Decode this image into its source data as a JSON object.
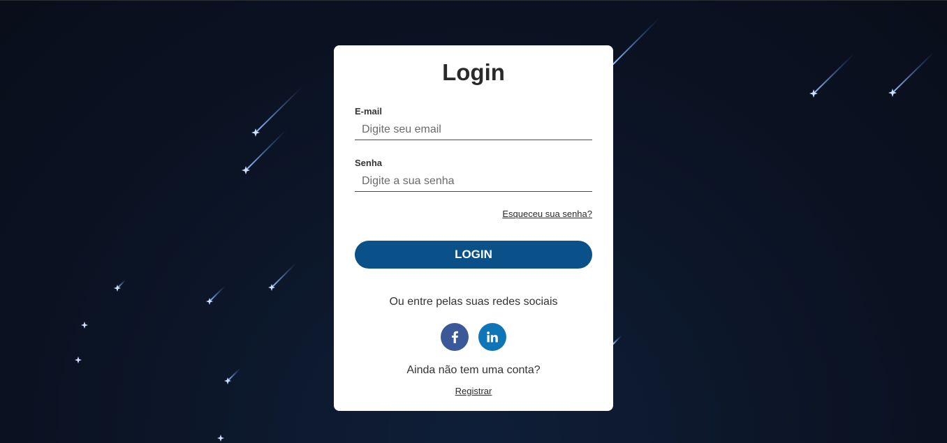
{
  "login": {
    "title": "Login",
    "email_label": "E-mail",
    "email_placeholder": "Digite seu email",
    "email_value": "",
    "password_label": "Senha",
    "password_placeholder": "Digite a sua senha",
    "password_value": "",
    "forgot_link": "Esqueceu sua senha?",
    "login_button": "LOGIN",
    "social_text": "Ou entre pelas suas redes sociais",
    "social": [
      {
        "icon": "facebook-icon",
        "color": "#3b5998"
      },
      {
        "icon": "linkedin-icon",
        "color": "#0e76b6"
      }
    ],
    "no_account_text": "Ainda não tem uma conta?",
    "register_link": "Registrar"
  },
  "colors": {
    "background": "#0a1120",
    "card": "#ffffff",
    "primary_button": "#0b5189"
  }
}
